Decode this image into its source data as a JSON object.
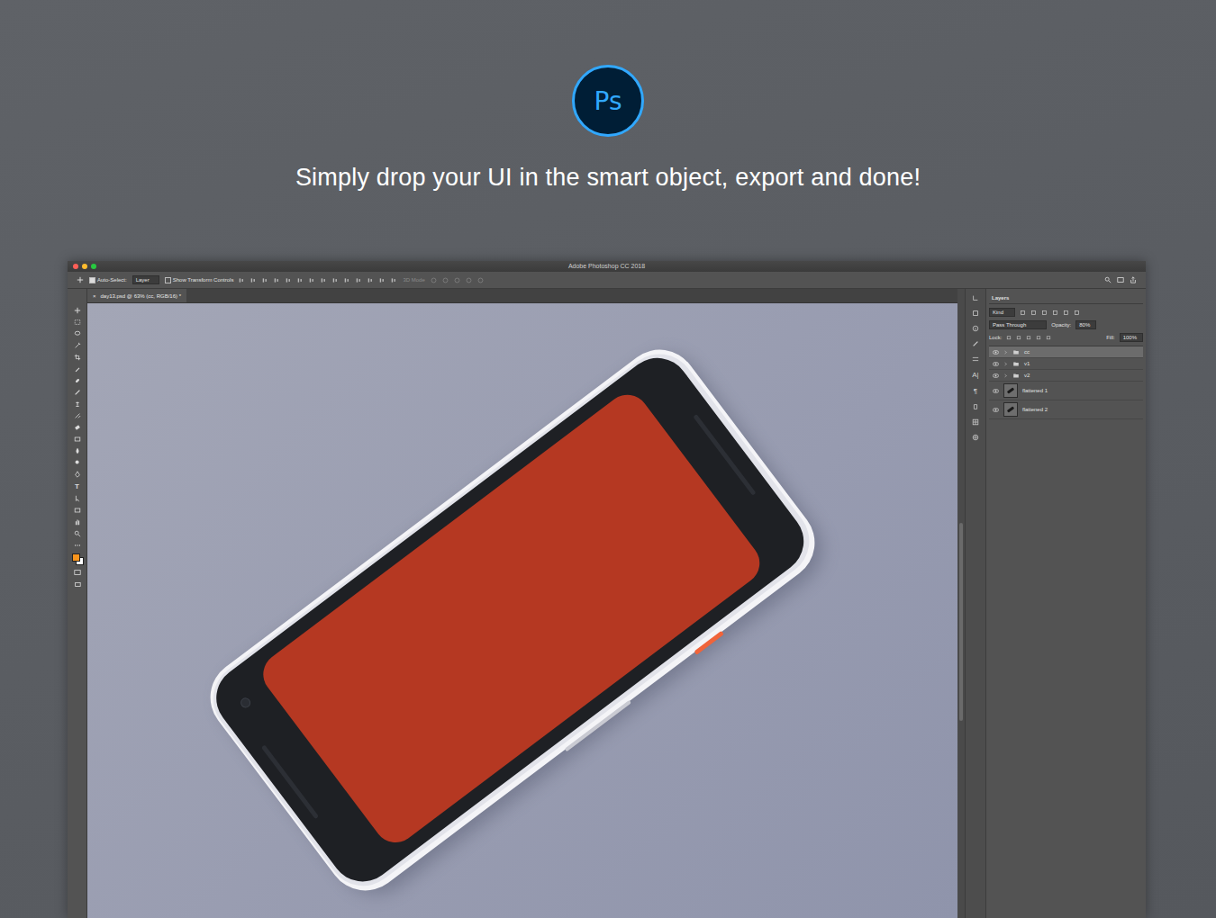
{
  "hero": {
    "logo": "Ps",
    "headline": "Simply drop your UI in the smart object, export and done!"
  },
  "window": {
    "title": "Adobe Photoshop CC 2018"
  },
  "options_bar": {
    "auto_select": {
      "label": "Auto-Select:",
      "checked": true
    },
    "target": "Layer",
    "show_transform": {
      "label": "Show Transform Controls",
      "checked": false
    },
    "mode": {
      "label": "3D Mode",
      "disabled": true
    }
  },
  "document_tab": {
    "label": "day13.psd @ 63% (cc, RGB/16) *",
    "close": "×"
  },
  "toolbar": {
    "type_tool": "T"
  },
  "side_icons": [
    "A|",
    "¶"
  ],
  "layers_panel": {
    "title": "Layers",
    "filter": "Kind",
    "blend_mode": "Pass Through",
    "opacity_label": "Opacity:",
    "opacity": "80%",
    "lock_label": "Lock:",
    "fill_label": "Fill:",
    "fill": "100%",
    "layers": [
      {
        "name": "cc",
        "kind": "group",
        "visible": true,
        "selected": true
      },
      {
        "name": "v1",
        "kind": "group",
        "visible": true,
        "selected": false
      },
      {
        "name": "v2",
        "kind": "group",
        "visible": true,
        "selected": false
      },
      {
        "name": "flattened 1",
        "kind": "smart",
        "visible": true,
        "selected": false
      },
      {
        "name": "flattened 2",
        "kind": "smart",
        "visible": true,
        "selected": false
      }
    ]
  }
}
